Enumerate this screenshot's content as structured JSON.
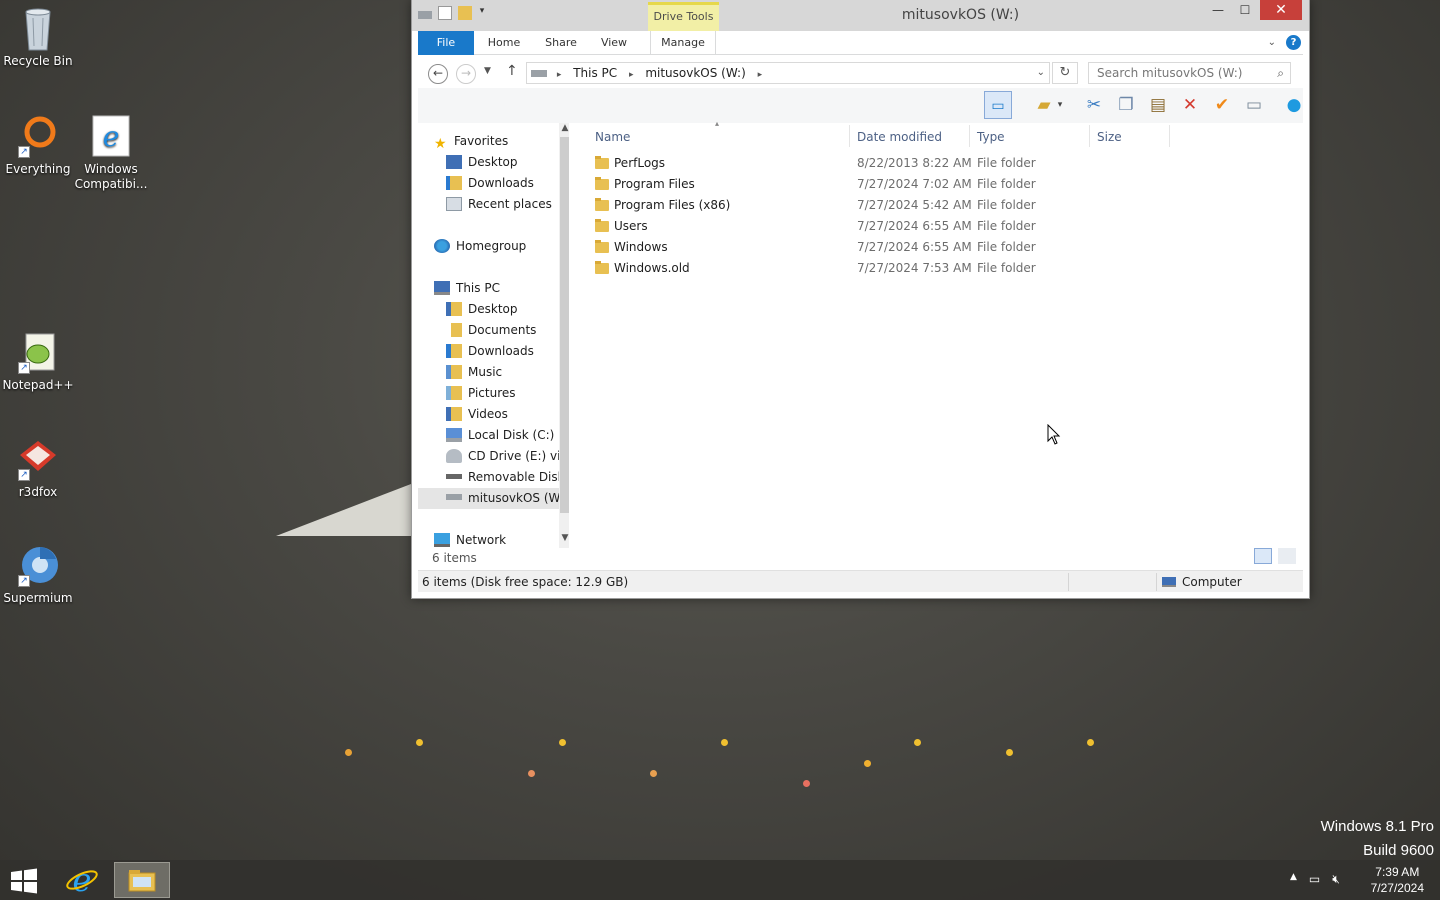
{
  "desktop": {
    "icons": [
      {
        "label": "Recycle Bin"
      },
      {
        "label": "Everything"
      },
      {
        "label": "Windows Compatibi..."
      },
      {
        "label": "Notepad++"
      },
      {
        "label": "r3dfox"
      },
      {
        "label": "Supermium"
      }
    ],
    "watermark": {
      "line1": "Windows 8.1 Pro",
      "line2": "Build 9600"
    }
  },
  "window": {
    "title": "mitusovkOS (W:)",
    "contextual_tab": "Drive Tools",
    "controls": {
      "minimize": "—",
      "maximize": "☐",
      "close": "✕"
    },
    "ribbon_tabs": [
      "File",
      "Home",
      "Share",
      "View",
      "Manage"
    ],
    "address": {
      "crumbs": [
        "This PC",
        "mitusovkOS (W:)"
      ]
    },
    "search": {
      "placeholder": "Search mitusovkOS (W:)"
    },
    "nav": {
      "favorites": "Favorites",
      "fav_items": [
        "Desktop",
        "Downloads",
        "Recent places"
      ],
      "homegroup": "Homegroup",
      "this_pc": "This PC",
      "pc_items": [
        "Desktop",
        "Documents",
        "Downloads",
        "Music",
        "Pictures",
        "Videos",
        "Local Disk (C:)",
        "CD Drive (E:) virti",
        "Removable Disk (",
        "mitusovkOS (W:)"
      ],
      "network": "Network"
    },
    "items_count": "6 items",
    "columns": [
      "Name",
      "Date modified",
      "Type",
      "Size"
    ],
    "files": [
      {
        "name": "PerfLogs",
        "date": "8/22/2013 8:22 AM",
        "type": "File folder"
      },
      {
        "name": "Program Files",
        "date": "7/27/2024 7:02 AM",
        "type": "File folder"
      },
      {
        "name": "Program Files (x86)",
        "date": "7/27/2024 5:42 AM",
        "type": "File folder"
      },
      {
        "name": "Users",
        "date": "7/27/2024 6:55 AM",
        "type": "File folder"
      },
      {
        "name": "Windows",
        "date": "7/27/2024 6:55 AM",
        "type": "File folder"
      },
      {
        "name": "Windows.old",
        "date": "7/27/2024 7:53 AM",
        "type": "File folder"
      }
    ],
    "status": {
      "left": "6 items (Disk free space: 12.9 GB)",
      "right": "Computer"
    }
  },
  "taskbar": {
    "clock_time": "7:39 AM",
    "clock_date": "7/27/2024"
  },
  "colors": {
    "accent": "#1979ca",
    "close": "#c7403a",
    "drive_tools": "#f2efa6"
  }
}
